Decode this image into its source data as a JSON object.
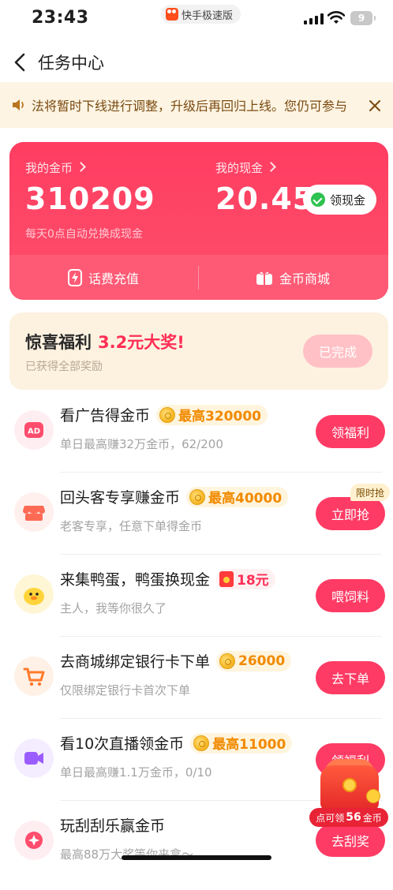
{
  "status_bar": {
    "time": "23:43",
    "app_name": "快手极速版",
    "battery": "9"
  },
  "nav": {
    "title": "任务中心"
  },
  "notice": {
    "text": "法将暂时下线进行调整，升级后再回归上线。您仍可参与"
  },
  "wallet": {
    "coins_label": "我的金币",
    "coins_value": "310209",
    "coins_note": "每天0点自动兑换成现金",
    "cash_label": "我的现金",
    "cash_value": "20.45",
    "cash_button": "领现金",
    "recharge_label": "话费充值",
    "mall_label": "金币商城"
  },
  "surprise": {
    "title": "惊喜福利",
    "highlight": "3.2元大奖!",
    "sub": "已获得全部奖励",
    "button": "已完成"
  },
  "tasks": [
    {
      "title": "看广告得金币",
      "reward": "最高320000",
      "sub": "单日最高赚32万金币，62/200",
      "button": "领福利",
      "icon": "ad-icon"
    },
    {
      "title": "回头客专享赚金币",
      "reward": "最高40000",
      "sub": "老客专享，任意下单得金币",
      "button": "立即抢",
      "tag": "限时抢",
      "icon": "shop-icon"
    },
    {
      "title": "来集鸭蛋，鸭蛋换现金",
      "reward": "18元",
      "sub": "主人，我等你很久了",
      "button": "喂饲料",
      "icon": "duck-icon"
    },
    {
      "title": "去商城绑定银行卡下单",
      "reward": "26000",
      "sub": "仅限绑定银行卡首次下单",
      "button": "去下单",
      "icon": "cart-icon"
    },
    {
      "title": "看10次直播领金币",
      "reward": "最高11000",
      "sub": "单日最高赚1.1万金币，0/10",
      "button": "领福利",
      "icon": "live-icon"
    },
    {
      "title": "玩刮刮乐赢金币",
      "reward": "",
      "sub": "最高88万大奖等你来拿～",
      "button": "去刮奖",
      "icon": "scratch-icon"
    }
  ],
  "chest": {
    "prefix": "点可领",
    "amount": "56",
    "suffix": "金币"
  },
  "colors": {
    "primary": "#fe3b64",
    "coin_orange": "#f18a00",
    "notice_bg": "#fdf4e3"
  }
}
